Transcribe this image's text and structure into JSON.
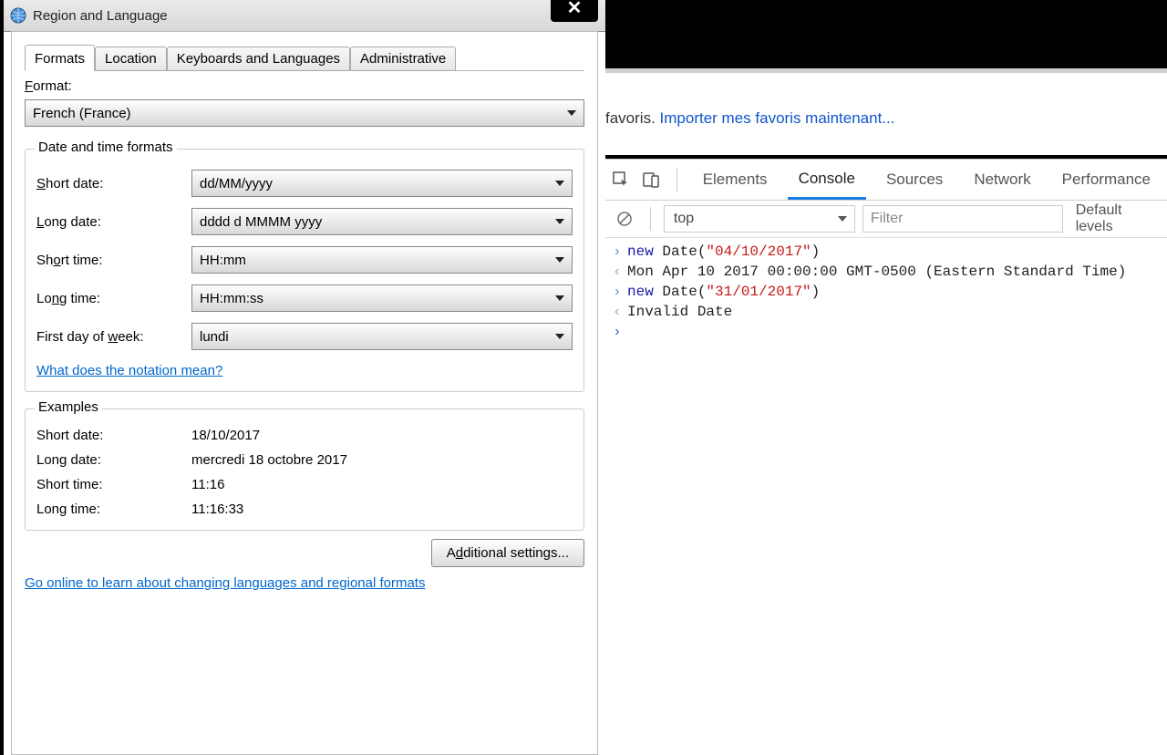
{
  "dialog": {
    "title": "Region and Language",
    "close_label": "×",
    "tabs": [
      "Formats",
      "Location",
      "Keyboards and Languages",
      "Administrative"
    ],
    "active_tab": 0,
    "format_label_pre": "F",
    "format_label_post": "ormat:",
    "format_value": "French (France)",
    "formats_group_legend": "Date and time formats",
    "rows": {
      "short_date": {
        "label_pre": "S",
        "label_mid": "hort date:",
        "value": "dd/MM/yyyy"
      },
      "long_date": {
        "label_pre": "L",
        "label_mid": "ong date:",
        "value": "dddd d MMMM yyyy"
      },
      "short_time": {
        "label_pre": "Sh",
        "label_mid": "o",
        "label_mid2": "rt time:",
        "value": "HH:mm"
      },
      "long_time": {
        "label_pre": "Lo",
        "label_mid": "n",
        "label_mid2": "g time:",
        "value": "HH:mm:ss"
      },
      "first_day": {
        "label_pre": "First day of ",
        "label_mid": "w",
        "label_mid2": "eek:",
        "value": "lundi"
      }
    },
    "notation_link": "What does the notation mean?",
    "examples_legend": "Examples",
    "examples": {
      "short_date": {
        "label": "Short date:",
        "value": "18/10/2017"
      },
      "long_date": {
        "label": "Long date:",
        "value": "mercredi 18 octobre 2017"
      },
      "short_time": {
        "label": "Short time:",
        "value": "11:16"
      },
      "long_time": {
        "label": "Long time:",
        "value": "11:16:33"
      }
    },
    "additional_btn_pre": "A",
    "additional_btn_mid": "d",
    "additional_btn_post": "ditional settings...",
    "online_link": "Go online to learn about changing languages and regional formats"
  },
  "browser": {
    "favoris_text": " favoris. ",
    "favoris_link": "Importer mes favoris maintenant..."
  },
  "devtools": {
    "tabs": [
      "Elements",
      "Console",
      "Sources",
      "Network",
      "Performance"
    ],
    "active_tab": 1,
    "context": "top",
    "filter_placeholder": "Filter",
    "default_levels": "Default levels",
    "lines": [
      {
        "kind": "in",
        "tokens": [
          {
            "t": "kw",
            "v": "new "
          },
          {
            "t": "plain",
            "v": "Date("
          },
          {
            "t": "str",
            "v": "\"04/10/2017\""
          },
          {
            "t": "plain",
            "v": ")"
          }
        ]
      },
      {
        "kind": "out",
        "tokens": [
          {
            "t": "plain",
            "v": "Mon Apr 10 2017 00:00:00 GMT-0500 (Eastern Standard Time)"
          }
        ]
      },
      {
        "kind": "in",
        "tokens": [
          {
            "t": "kw",
            "v": "new "
          },
          {
            "t": "plain",
            "v": "Date("
          },
          {
            "t": "str",
            "v": "\"31/01/2017\""
          },
          {
            "t": "plain",
            "v": ")"
          }
        ]
      },
      {
        "kind": "out",
        "tokens": [
          {
            "t": "plain",
            "v": "Invalid Date"
          }
        ]
      }
    ]
  }
}
